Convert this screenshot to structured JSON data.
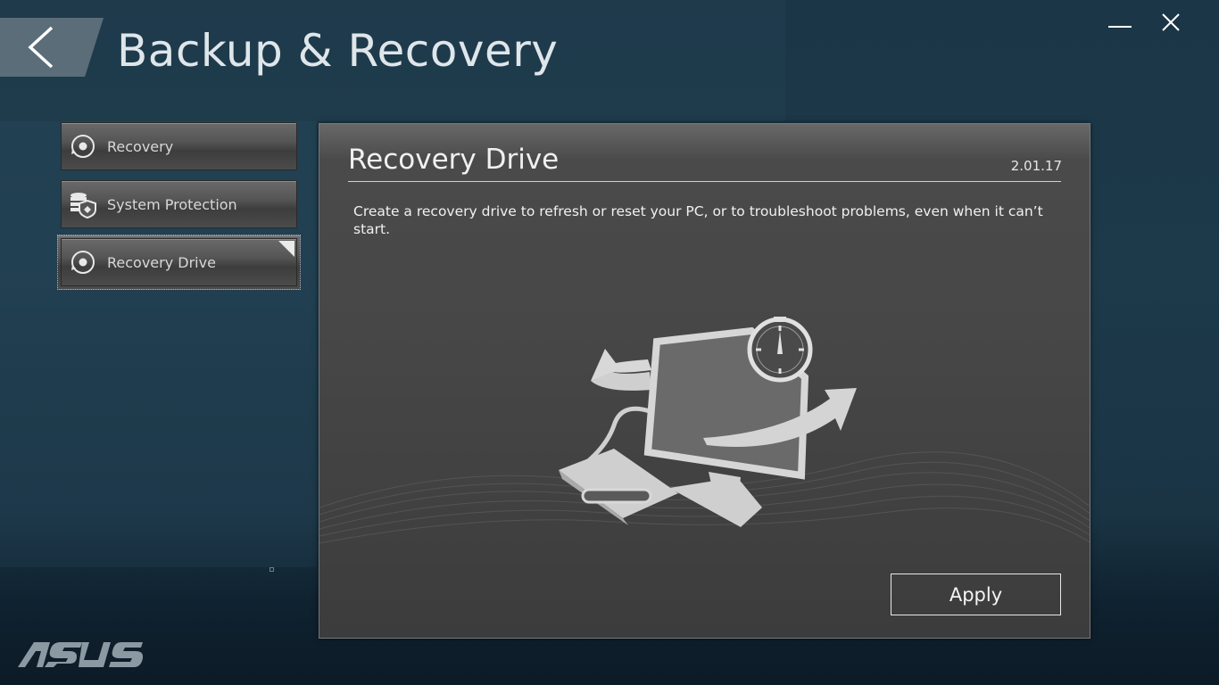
{
  "window": {
    "title": "Backup & Recovery",
    "back_icon": "chevron-left-icon",
    "minimize_icon": "minimize-icon",
    "close_icon": "close-icon"
  },
  "sidebar": {
    "items": [
      {
        "label": "Recovery",
        "icon": "recovery-disc-icon",
        "selected": false
      },
      {
        "label": "System Protection",
        "icon": "database-shield-icon",
        "selected": false
      },
      {
        "label": "Recovery Drive",
        "icon": "recovery-disc-icon",
        "selected": true
      }
    ]
  },
  "content": {
    "title": "Recovery Drive",
    "version": "2.01.17",
    "description": "Create a recovery drive to refresh or reset your PC, or to troubleshoot problems, even when it can’t start.",
    "illustration": "recovery-drive-illustration",
    "apply_label": "Apply"
  },
  "footer": {
    "logo_text": "ASUS"
  },
  "colors": {
    "background": "#1b3646",
    "panel": "#474747",
    "accent_text": "#f0f0f0"
  }
}
